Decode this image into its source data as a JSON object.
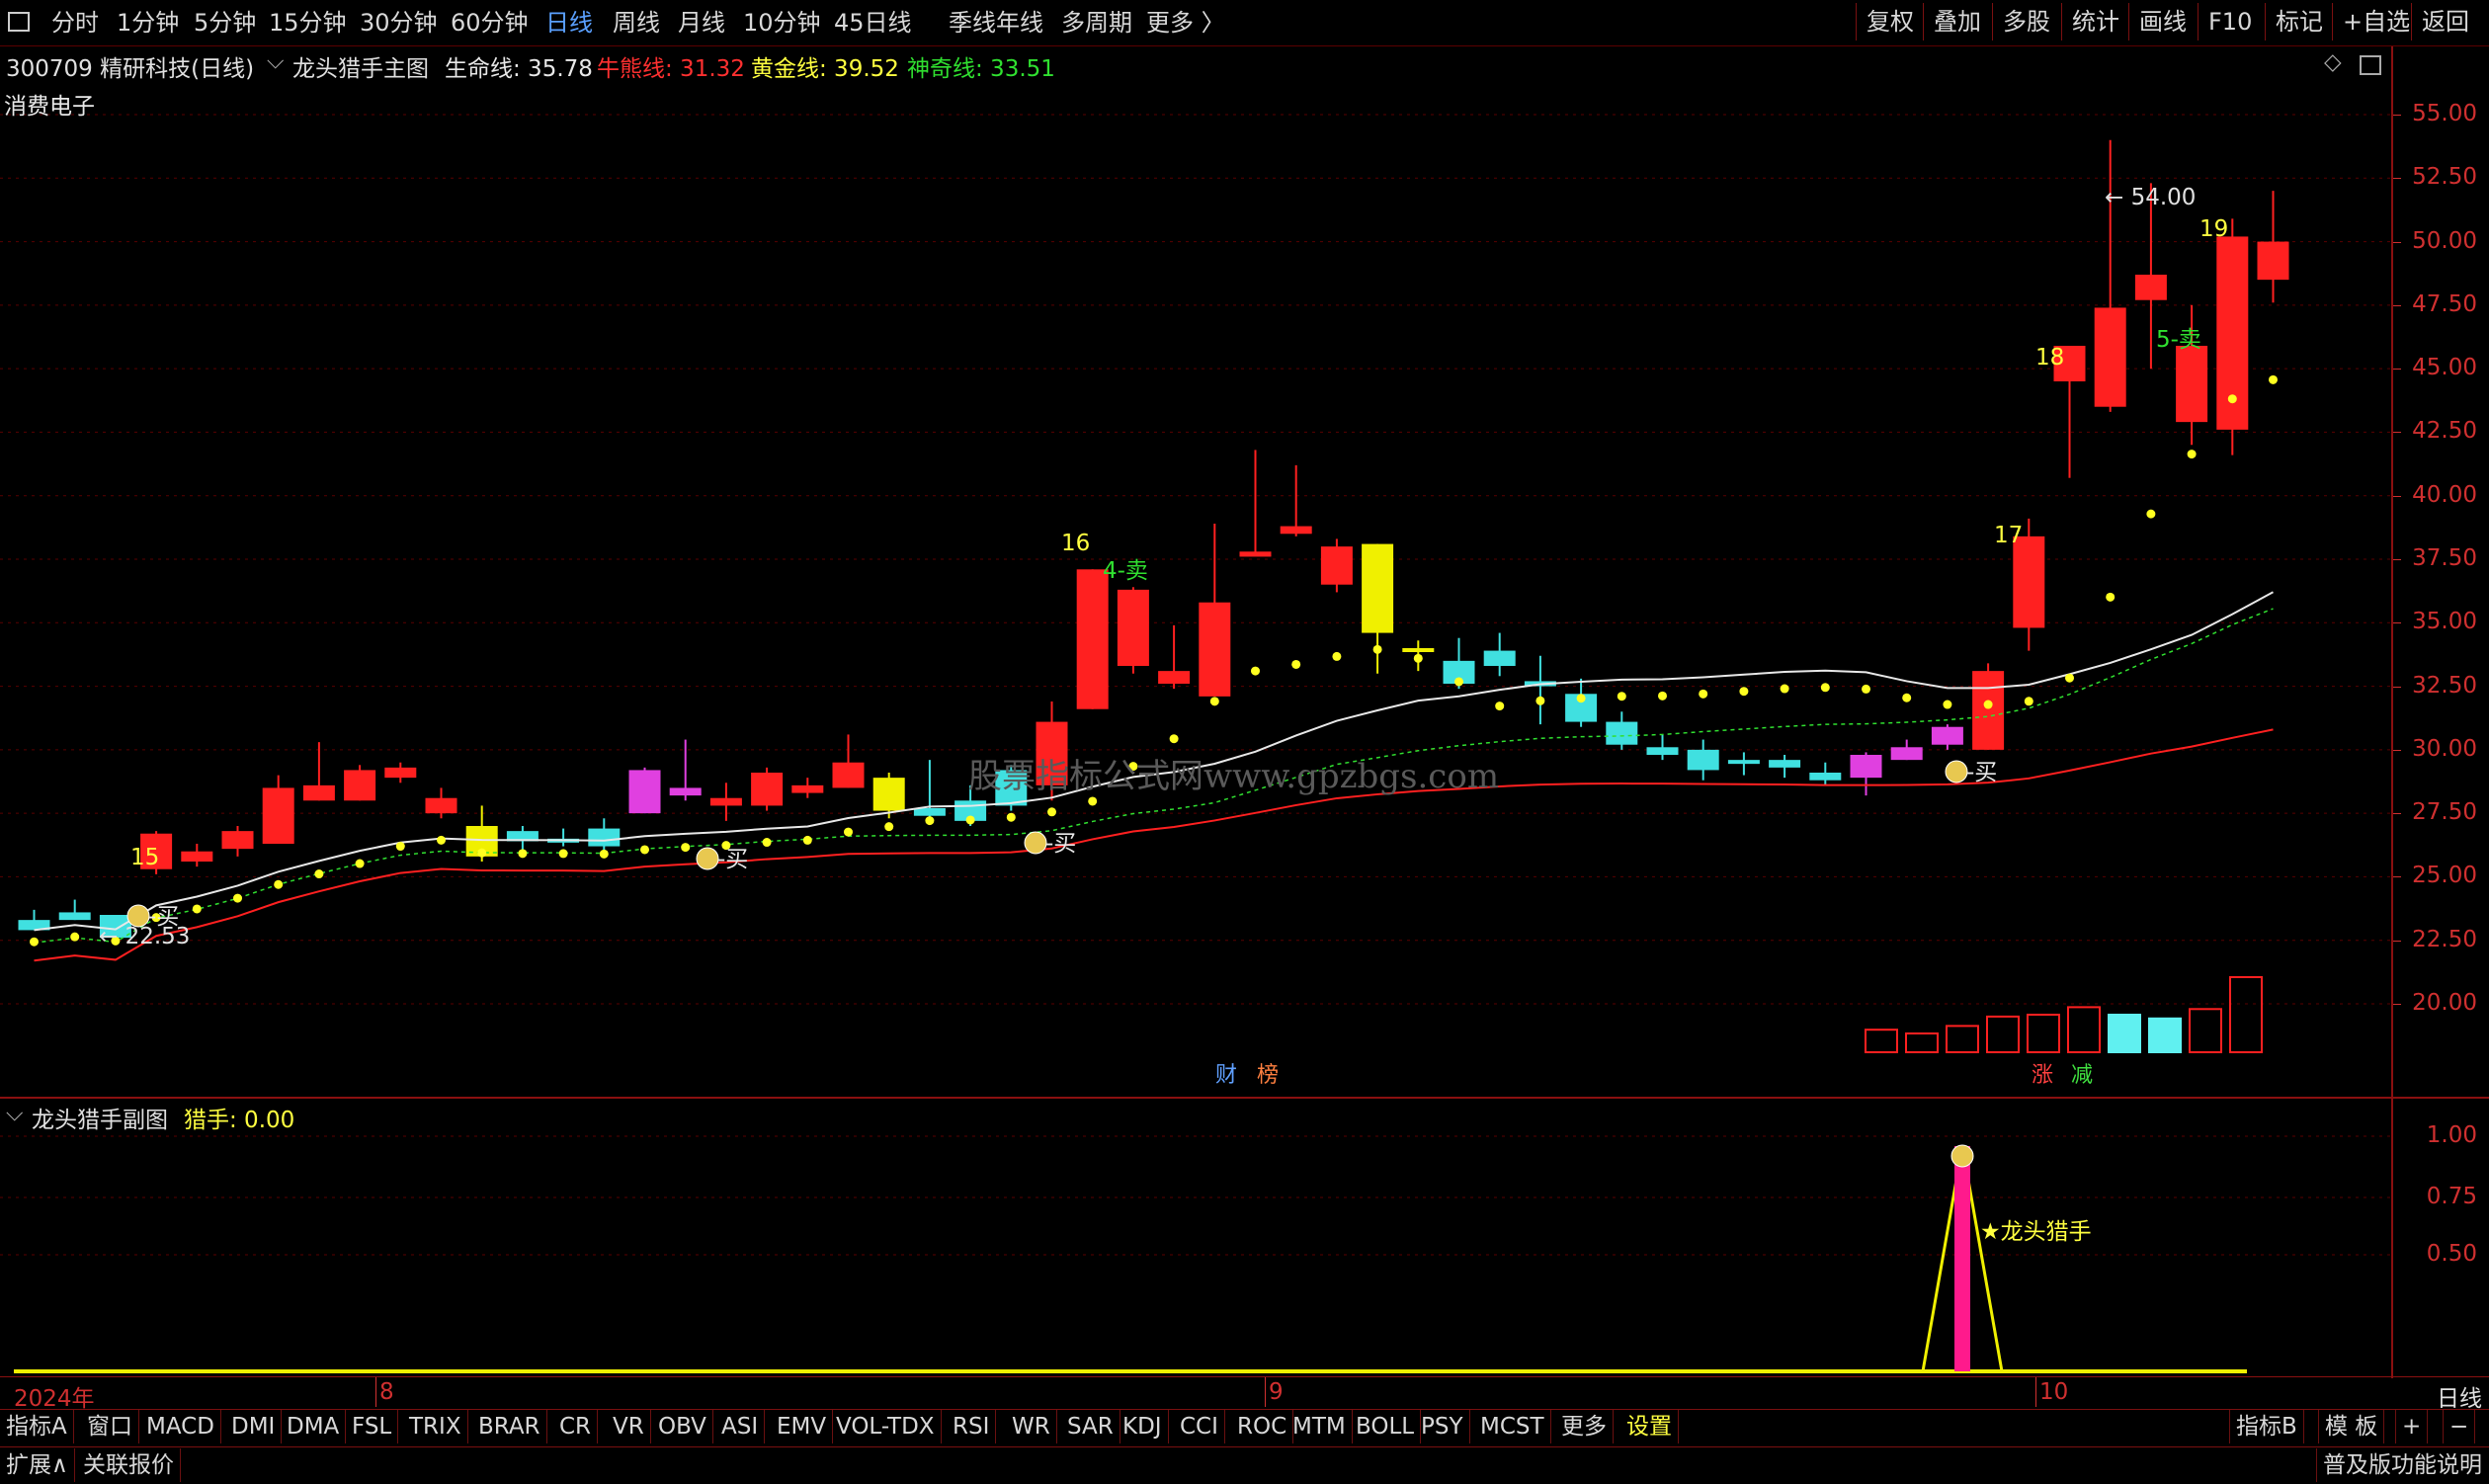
{
  "toolbar": {
    "periods": [
      "分时",
      "1分钟",
      "5分钟",
      "15分钟",
      "30分钟",
      "60分钟",
      "日线",
      "周线",
      "月线",
      "10分钟",
      "45日线",
      "季线",
      "年线",
      "多周期",
      "更多"
    ],
    "active_period": "日线",
    "right_buttons": [
      "复权",
      "叠加",
      "多股",
      "统计",
      "画线",
      "F10",
      "标记",
      "+自选",
      "返回"
    ]
  },
  "header": {
    "stock": "300709 精研科技(日线)",
    "indicator_name": "龙头猎手主图",
    "lines": [
      {
        "label": "生命线: 35.78",
        "color": "#e8e8e8"
      },
      {
        "label": "牛熊线: 31.32",
        "color": "#ff3030"
      },
      {
        "label": "黄金线: 39.52",
        "color": "#ffff40"
      },
      {
        "label": "神奇线: 33.51",
        "color": "#30e030"
      }
    ],
    "sector": "消费电子"
  },
  "watermark": "股票指标公式网www.gpzbgs.com",
  "chart_data": {
    "type": "candlestick",
    "ylim": [
      18.5,
      56.5
    ],
    "y_ticks": [
      "55.00",
      "52.50",
      "50.00",
      "47.50",
      "45.00",
      "42.50",
      "40.00",
      "37.50",
      "35.00",
      "32.50",
      "30.00",
      "27.50",
      "25.00",
      "22.50",
      "20.00"
    ],
    "x_labels": [
      "2024年",
      "8",
      "9",
      "10"
    ],
    "candles": [
      {
        "o": 23.3,
        "h": 23.7,
        "l": 22.9,
        "c": 22.9,
        "t": "cyan"
      },
      {
        "o": 23.6,
        "h": 24.1,
        "l": 23.3,
        "c": 23.3,
        "t": "cyan"
      },
      {
        "o": 23.5,
        "h": 23.5,
        "l": 22.53,
        "c": 22.6,
        "t": "cyan"
      },
      {
        "o": 25.3,
        "h": 26.8,
        "l": 25.1,
        "c": 26.7,
        "t": "red"
      },
      {
        "o": 26.0,
        "h": 26.3,
        "l": 25.4,
        "c": 25.6,
        "t": "red"
      },
      {
        "o": 26.1,
        "h": 27.0,
        "l": 25.8,
        "c": 26.8,
        "t": "red"
      },
      {
        "o": 26.3,
        "h": 29.0,
        "l": 26.3,
        "c": 28.5,
        "t": "red"
      },
      {
        "o": 28.0,
        "h": 30.3,
        "l": 28.0,
        "c": 28.6,
        "t": "red"
      },
      {
        "o": 28.0,
        "h": 29.4,
        "l": 28.0,
        "c": 29.2,
        "t": "red"
      },
      {
        "o": 28.9,
        "h": 29.5,
        "l": 28.7,
        "c": 29.3,
        "t": "red"
      },
      {
        "o": 27.5,
        "h": 28.5,
        "l": 27.3,
        "c": 28.1,
        "t": "red"
      },
      {
        "o": 27.0,
        "h": 27.8,
        "l": 25.6,
        "c": 25.8,
        "t": "yellow"
      },
      {
        "o": 26.8,
        "h": 27.0,
        "l": 26.0,
        "c": 26.4,
        "t": "cyan"
      },
      {
        "o": 26.5,
        "h": 26.9,
        "l": 26.2,
        "c": 26.4,
        "t": "cyan"
      },
      {
        "o": 26.9,
        "h": 27.3,
        "l": 25.9,
        "c": 26.2,
        "t": "cyan"
      },
      {
        "o": 27.5,
        "h": 29.3,
        "l": 27.5,
        "c": 29.2,
        "t": "magenta"
      },
      {
        "o": 28.5,
        "h": 30.4,
        "l": 28.0,
        "c": 28.2,
        "t": "magenta"
      },
      {
        "o": 27.8,
        "h": 28.7,
        "l": 27.2,
        "c": 28.1,
        "t": "red"
      },
      {
        "o": 27.8,
        "h": 29.3,
        "l": 27.6,
        "c": 29.1,
        "t": "red"
      },
      {
        "o": 28.3,
        "h": 28.9,
        "l": 28.1,
        "c": 28.6,
        "t": "red"
      },
      {
        "o": 28.5,
        "h": 30.6,
        "l": 28.5,
        "c": 29.5,
        "t": "red"
      },
      {
        "o": 28.9,
        "h": 29.1,
        "l": 27.3,
        "c": 27.6,
        "t": "yellow"
      },
      {
        "o": 27.7,
        "h": 29.6,
        "l": 27.3,
        "c": 27.4,
        "t": "cyan"
      },
      {
        "o": 28.0,
        "h": 28.6,
        "l": 27.0,
        "c": 27.2,
        "t": "cyan"
      },
      {
        "o": 29.2,
        "h": 29.4,
        "l": 27.6,
        "c": 27.8,
        "t": "cyan"
      },
      {
        "o": 28.6,
        "h": 31.9,
        "l": 28.0,
        "c": 31.1,
        "t": "red"
      },
      {
        "o": 31.6,
        "h": 37.1,
        "l": 31.6,
        "c": 37.1,
        "t": "red"
      },
      {
        "o": 33.3,
        "h": 36.4,
        "l": 33.0,
        "c": 36.3,
        "t": "red"
      },
      {
        "o": 32.6,
        "h": 34.9,
        "l": 32.4,
        "c": 33.1,
        "t": "red"
      },
      {
        "o": 32.1,
        "h": 38.9,
        "l": 32.1,
        "c": 35.8,
        "t": "red"
      },
      {
        "o": 37.8,
        "h": 41.8,
        "l": 37.7,
        "c": 37.6,
        "t": "red"
      },
      {
        "o": 38.8,
        "h": 41.2,
        "l": 38.4,
        "c": 38.5,
        "t": "red"
      },
      {
        "o": 36.5,
        "h": 38.3,
        "l": 36.2,
        "c": 38.0,
        "t": "red"
      },
      {
        "o": 38.1,
        "h": 38.1,
        "l": 33.0,
        "c": 34.6,
        "t": "yellow"
      },
      {
        "o": 34.0,
        "h": 34.3,
        "l": 33.1,
        "c": 33.9,
        "t": "yellow"
      },
      {
        "o": 33.5,
        "h": 34.4,
        "l": 32.4,
        "c": 32.6,
        "t": "cyan"
      },
      {
        "o": 33.9,
        "h": 34.6,
        "l": 32.9,
        "c": 33.3,
        "t": "cyan"
      },
      {
        "o": 32.7,
        "h": 33.7,
        "l": 31.0,
        "c": 32.5,
        "t": "cyan"
      },
      {
        "o": 32.2,
        "h": 32.8,
        "l": 30.9,
        "c": 31.1,
        "t": "cyan"
      },
      {
        "o": 31.1,
        "h": 31.5,
        "l": 30.0,
        "c": 30.2,
        "t": "cyan"
      },
      {
        "o": 30.1,
        "h": 30.6,
        "l": 29.6,
        "c": 29.8,
        "t": "cyan"
      },
      {
        "o": 30.0,
        "h": 30.4,
        "l": 28.8,
        "c": 29.2,
        "t": "cyan"
      },
      {
        "o": 29.6,
        "h": 29.9,
        "l": 29.0,
        "c": 29.5,
        "t": "cyan"
      },
      {
        "o": 29.6,
        "h": 29.8,
        "l": 28.9,
        "c": 29.3,
        "t": "cyan"
      },
      {
        "o": 29.1,
        "h": 29.5,
        "l": 28.6,
        "c": 28.8,
        "t": "cyan"
      },
      {
        "o": 28.9,
        "h": 29.9,
        "l": 28.2,
        "c": 29.8,
        "t": "magenta"
      },
      {
        "o": 29.6,
        "h": 30.4,
        "l": 29.6,
        "c": 30.1,
        "t": "magenta"
      },
      {
        "o": 30.2,
        "h": 31.0,
        "l": 30.0,
        "c": 30.9,
        "t": "magenta"
      },
      {
        "o": 30.0,
        "h": 33.4,
        "l": 30.0,
        "c": 33.1,
        "t": "red"
      },
      {
        "o": 34.8,
        "h": 39.1,
        "l": 33.9,
        "c": 38.4,
        "t": "red"
      },
      {
        "o": 44.5,
        "h": 45.6,
        "l": 40.7,
        "c": 45.9,
        "t": "red"
      },
      {
        "o": 43.5,
        "h": 54.0,
        "l": 43.3,
        "c": 47.4,
        "t": "red"
      },
      {
        "o": 47.7,
        "h": 52.3,
        "l": 45.0,
        "c": 48.7,
        "t": "red"
      },
      {
        "o": 42.9,
        "h": 47.5,
        "l": 42.0,
        "c": 45.9,
        "t": "red"
      },
      {
        "o": 42.6,
        "h": 50.9,
        "l": 41.6,
        "c": 50.2,
        "t": "red"
      },
      {
        "o": 48.5,
        "h": 52.0,
        "l": 47.6,
        "c": 50.0,
        "t": "red"
      }
    ],
    "volume_bars": [
      1.2,
      1.0,
      1.4,
      1.9,
      2.0,
      2.4,
      2.0,
      1.8,
      2.3,
      4.0
    ],
    "volume_cyan": [
      6,
      7
    ],
    "annotations": {
      "high_label": "54.00",
      "low_label": "22.53",
      "numbers": [
        "15",
        "16",
        "17",
        "18",
        "19"
      ],
      "sell_labels": [
        "4-卖",
        "5-卖"
      ],
      "buy_label": "-买",
      "tags": [
        "财",
        "榜",
        "涨",
        "减"
      ]
    },
    "sub_chart": {
      "title": "龙头猎手副图",
      "value_label": "猎手: 0.00",
      "y_ticks": [
        "1.00",
        "0.75",
        "0.50"
      ],
      "signal_text": "★龙头猎手"
    }
  },
  "bottom_tabs": [
    "指标A",
    "窗口",
    "MACD",
    "DMI",
    "DMA",
    "FSL",
    "TRIX",
    "BRAR",
    "CR",
    "VR",
    "OBV",
    "ASI",
    "EMV",
    "VOL-TDX",
    "RSI",
    "WR",
    "SAR",
    "KDJ",
    "CCI",
    "ROC",
    "MTM",
    "BOLL",
    "PSY",
    "MCST",
    "更多",
    "设置"
  ],
  "right_tabs": [
    "指标B",
    "模 板",
    "+",
    "−"
  ],
  "period_label": "日线",
  "status": {
    "left": [
      "扩展∧",
      "关联报价"
    ],
    "right": "普及版功能说明"
  },
  "colors": {
    "up": "#ff2020",
    "down": "#40e0e0",
    "accent": "#5aa0ff",
    "axis": "#d03030"
  }
}
